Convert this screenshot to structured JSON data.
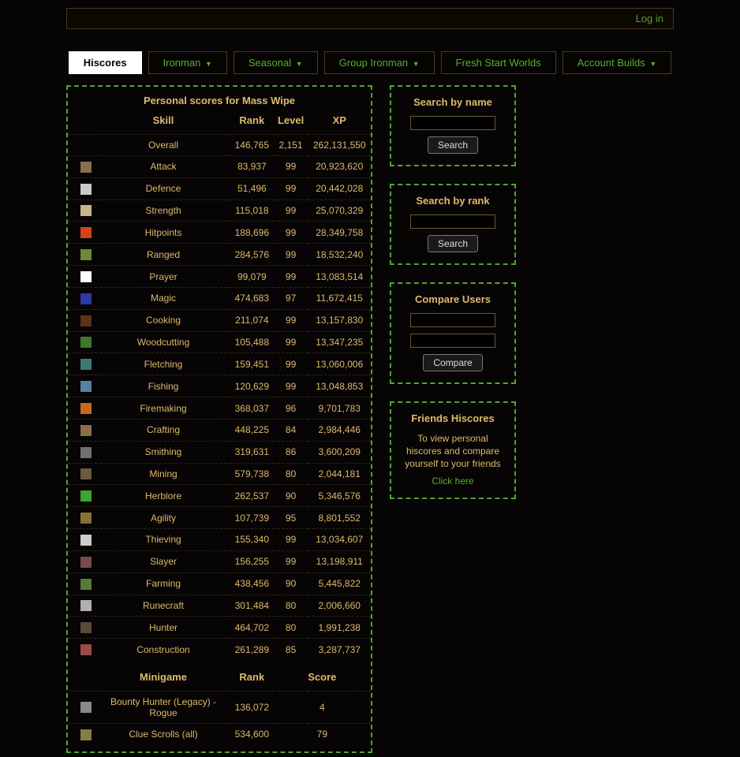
{
  "topbar": {
    "login": "Log in"
  },
  "tabs": [
    {
      "label": "Hiscores",
      "active": true,
      "dropdown": false
    },
    {
      "label": "Ironman",
      "active": false,
      "dropdown": true
    },
    {
      "label": "Seasonal",
      "active": false,
      "dropdown": true
    },
    {
      "label": "Group Ironman",
      "active": false,
      "dropdown": true
    },
    {
      "label": "Fresh Start Worlds",
      "active": false,
      "dropdown": false
    },
    {
      "label": "Account Builds",
      "active": false,
      "dropdown": true
    }
  ],
  "scores_title": "Personal scores for Mass Wipe",
  "headers": {
    "skill": "Skill",
    "rank": "Rank",
    "level": "Level",
    "xp": "XP"
  },
  "skills": [
    {
      "name": "Overall",
      "rank": "146,765",
      "level": "2,151",
      "xp": "262,131,550",
      "icon": ""
    },
    {
      "name": "Attack",
      "rank": "83,937",
      "level": "99",
      "xp": "20,923,620",
      "icon": "#8a6f4a"
    },
    {
      "name": "Defence",
      "rank": "51,496",
      "level": "99",
      "xp": "20,442,028",
      "icon": "#c9c9c9"
    },
    {
      "name": "Strength",
      "rank": "115,018",
      "level": "99",
      "xp": "25,070,329",
      "icon": "#c9b48a"
    },
    {
      "name": "Hitpoints",
      "rank": "188,696",
      "level": "99",
      "xp": "28,349,758",
      "icon": "#d8421b"
    },
    {
      "name": "Ranged",
      "rank": "284,576",
      "level": "99",
      "xp": "18,532,240",
      "icon": "#6c8a3a"
    },
    {
      "name": "Prayer",
      "rank": "99,079",
      "level": "99",
      "xp": "13,083,514",
      "icon": "#ffffff"
    },
    {
      "name": "Magic",
      "rank": "474,683",
      "level": "97",
      "xp": "11,672,415",
      "icon": "#2f3a9e"
    },
    {
      "name": "Cooking",
      "rank": "211,074",
      "level": "99",
      "xp": "13,157,830",
      "icon": "#5a3517"
    },
    {
      "name": "Woodcutting",
      "rank": "105,488",
      "level": "99",
      "xp": "13,347,235",
      "icon": "#3a7a2a"
    },
    {
      "name": "Fletching",
      "rank": "159,451",
      "level": "99",
      "xp": "13,060,006",
      "icon": "#3c7a7a"
    },
    {
      "name": "Fishing",
      "rank": "120,629",
      "level": "99",
      "xp": "13,048,853",
      "icon": "#5a7ea8"
    },
    {
      "name": "Firemaking",
      "rank": "368,037",
      "level": "96",
      "xp": "9,701,783",
      "icon": "#c46a1e"
    },
    {
      "name": "Crafting",
      "rank": "448,225",
      "level": "84",
      "xp": "2,984,446",
      "icon": "#8a6f4a"
    },
    {
      "name": "Smithing",
      "rank": "319,631",
      "level": "86",
      "xp": "3,600,209",
      "icon": "#707070"
    },
    {
      "name": "Mining",
      "rank": "579,738",
      "level": "80",
      "xp": "2,044,181",
      "icon": "#6a5a40"
    },
    {
      "name": "Herblore",
      "rank": "262,537",
      "level": "90",
      "xp": "5,346,576",
      "icon": "#3aa82e"
    },
    {
      "name": "Agility",
      "rank": "107,739",
      "level": "95",
      "xp": "8,801,552",
      "icon": "#8a6f3a"
    },
    {
      "name": "Thieving",
      "rank": "155,340",
      "level": "99",
      "xp": "13,034,607",
      "icon": "#cccccc"
    },
    {
      "name": "Slayer",
      "rank": "156,255",
      "level": "99",
      "xp": "13,198,911",
      "icon": "#7a4a4a"
    },
    {
      "name": "Farming",
      "rank": "438,456",
      "level": "90",
      "xp": "5,445,822",
      "icon": "#5a7a3a"
    },
    {
      "name": "Runecraft",
      "rank": "301,484",
      "level": "80",
      "xp": "2,006,660",
      "icon": "#b0b0b0"
    },
    {
      "name": "Hunter",
      "rank": "464,702",
      "level": "80",
      "xp": "1,991,238",
      "icon": "#5a4a3a"
    },
    {
      "name": "Construction",
      "rank": "261,289",
      "level": "85",
      "xp": "3,287,737",
      "icon": "#9a4a4a"
    }
  ],
  "minigame_headers": {
    "name": "Minigame",
    "rank": "Rank",
    "score": "Score"
  },
  "minigames": [
    {
      "name": "Bounty Hunter (Legacy) - Rogue",
      "rank": "136,072",
      "score": "4",
      "icon": "#888888"
    },
    {
      "name": "Clue Scrolls (all)",
      "rank": "534,600",
      "score": "79",
      "icon": "#8a7a4a"
    }
  ],
  "sidebar": {
    "search_name": {
      "title": "Search by name",
      "btn": "Search"
    },
    "search_rank": {
      "title": "Search by rank",
      "btn": "Search"
    },
    "compare": {
      "title": "Compare Users",
      "btn": "Compare"
    },
    "friends": {
      "title": "Friends Hiscores",
      "text": "To view personal hiscores and compare yourself to your friends",
      "link": "Click here"
    }
  }
}
